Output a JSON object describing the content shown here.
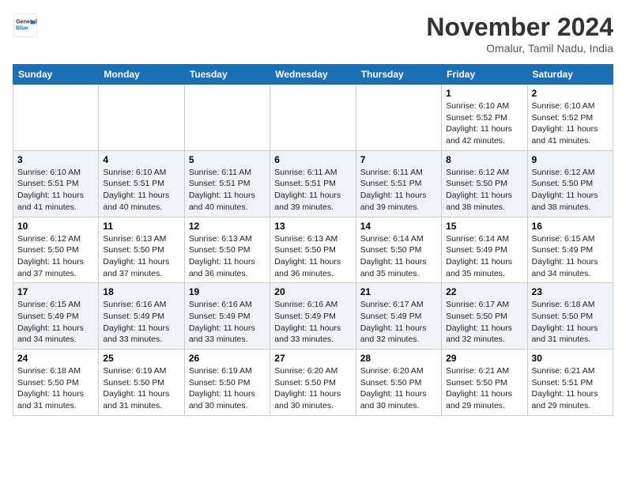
{
  "header": {
    "logo_line1": "General",
    "logo_line2": "Blue",
    "month": "November 2024",
    "location": "Omalur, Tamil Nadu, India"
  },
  "days_of_week": [
    "Sunday",
    "Monday",
    "Tuesday",
    "Wednesday",
    "Thursday",
    "Friday",
    "Saturday"
  ],
  "weeks": [
    [
      {
        "day": "",
        "info": ""
      },
      {
        "day": "",
        "info": ""
      },
      {
        "day": "",
        "info": ""
      },
      {
        "day": "",
        "info": ""
      },
      {
        "day": "",
        "info": ""
      },
      {
        "day": "1",
        "info": "Sunrise: 6:10 AM\nSunset: 5:52 PM\nDaylight: 11 hours and 42 minutes."
      },
      {
        "day": "2",
        "info": "Sunrise: 6:10 AM\nSunset: 5:52 PM\nDaylight: 11 hours and 41 minutes."
      }
    ],
    [
      {
        "day": "3",
        "info": "Sunrise: 6:10 AM\nSunset: 5:51 PM\nDaylight: 11 hours and 41 minutes."
      },
      {
        "day": "4",
        "info": "Sunrise: 6:10 AM\nSunset: 5:51 PM\nDaylight: 11 hours and 40 minutes."
      },
      {
        "day": "5",
        "info": "Sunrise: 6:11 AM\nSunset: 5:51 PM\nDaylight: 11 hours and 40 minutes."
      },
      {
        "day": "6",
        "info": "Sunrise: 6:11 AM\nSunset: 5:51 PM\nDaylight: 11 hours and 39 minutes."
      },
      {
        "day": "7",
        "info": "Sunrise: 6:11 AM\nSunset: 5:51 PM\nDaylight: 11 hours and 39 minutes."
      },
      {
        "day": "8",
        "info": "Sunrise: 6:12 AM\nSunset: 5:50 PM\nDaylight: 11 hours and 38 minutes."
      },
      {
        "day": "9",
        "info": "Sunrise: 6:12 AM\nSunset: 5:50 PM\nDaylight: 11 hours and 38 minutes."
      }
    ],
    [
      {
        "day": "10",
        "info": "Sunrise: 6:12 AM\nSunset: 5:50 PM\nDaylight: 11 hours and 37 minutes."
      },
      {
        "day": "11",
        "info": "Sunrise: 6:13 AM\nSunset: 5:50 PM\nDaylight: 11 hours and 37 minutes."
      },
      {
        "day": "12",
        "info": "Sunrise: 6:13 AM\nSunset: 5:50 PM\nDaylight: 11 hours and 36 minutes."
      },
      {
        "day": "13",
        "info": "Sunrise: 6:13 AM\nSunset: 5:50 PM\nDaylight: 11 hours and 36 minutes."
      },
      {
        "day": "14",
        "info": "Sunrise: 6:14 AM\nSunset: 5:50 PM\nDaylight: 11 hours and 35 minutes."
      },
      {
        "day": "15",
        "info": "Sunrise: 6:14 AM\nSunset: 5:49 PM\nDaylight: 11 hours and 35 minutes."
      },
      {
        "day": "16",
        "info": "Sunrise: 6:15 AM\nSunset: 5:49 PM\nDaylight: 11 hours and 34 minutes."
      }
    ],
    [
      {
        "day": "17",
        "info": "Sunrise: 6:15 AM\nSunset: 5:49 PM\nDaylight: 11 hours and 34 minutes."
      },
      {
        "day": "18",
        "info": "Sunrise: 6:16 AM\nSunset: 5:49 PM\nDaylight: 11 hours and 33 minutes."
      },
      {
        "day": "19",
        "info": "Sunrise: 6:16 AM\nSunset: 5:49 PM\nDaylight: 11 hours and 33 minutes."
      },
      {
        "day": "20",
        "info": "Sunrise: 6:16 AM\nSunset: 5:49 PM\nDaylight: 11 hours and 33 minutes."
      },
      {
        "day": "21",
        "info": "Sunrise: 6:17 AM\nSunset: 5:49 PM\nDaylight: 11 hours and 32 minutes."
      },
      {
        "day": "22",
        "info": "Sunrise: 6:17 AM\nSunset: 5:50 PM\nDaylight: 11 hours and 32 minutes."
      },
      {
        "day": "23",
        "info": "Sunrise: 6:18 AM\nSunset: 5:50 PM\nDaylight: 11 hours and 31 minutes."
      }
    ],
    [
      {
        "day": "24",
        "info": "Sunrise: 6:18 AM\nSunset: 5:50 PM\nDaylight: 11 hours and 31 minutes."
      },
      {
        "day": "25",
        "info": "Sunrise: 6:19 AM\nSunset: 5:50 PM\nDaylight: 11 hours and 31 minutes."
      },
      {
        "day": "26",
        "info": "Sunrise: 6:19 AM\nSunset: 5:50 PM\nDaylight: 11 hours and 30 minutes."
      },
      {
        "day": "27",
        "info": "Sunrise: 6:20 AM\nSunset: 5:50 PM\nDaylight: 11 hours and 30 minutes."
      },
      {
        "day": "28",
        "info": "Sunrise: 6:20 AM\nSunset: 5:50 PM\nDaylight: 11 hours and 30 minutes."
      },
      {
        "day": "29",
        "info": "Sunrise: 6:21 AM\nSunset: 5:50 PM\nDaylight: 11 hours and 29 minutes."
      },
      {
        "day": "30",
        "info": "Sunrise: 6:21 AM\nSunset: 5:51 PM\nDaylight: 11 hours and 29 minutes."
      }
    ]
  ]
}
